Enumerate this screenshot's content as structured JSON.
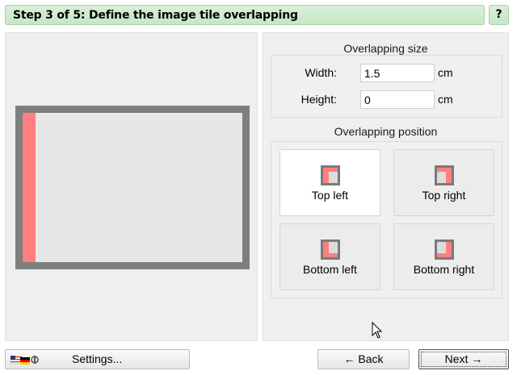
{
  "header": {
    "title": "Step 3 of 5: Define the image tile overlapping",
    "help_label": "?"
  },
  "overlap_size": {
    "title": "Overlapping size",
    "width_label": "Width:",
    "width_value": "1.5",
    "height_label": "Height:",
    "height_value": "0",
    "unit": "cm"
  },
  "overlap_position": {
    "title": "Overlapping position",
    "options": [
      {
        "label": "Top left",
        "selected": true
      },
      {
        "label": "Top right",
        "selected": false
      },
      {
        "label": "Bottom left",
        "selected": false
      },
      {
        "label": "Bottom right",
        "selected": false
      }
    ]
  },
  "footer": {
    "settings_label": "Settings...",
    "back_label": "← Back",
    "next_label": "Next →"
  },
  "colors": {
    "header_bg": "#c6e6c6",
    "overlap": "#ff7f7f",
    "tile_border": "#7f7f7f"
  },
  "icons": [
    "language-flags-icon",
    "overlap-position-icon",
    "mouse-cursor-icon"
  ]
}
